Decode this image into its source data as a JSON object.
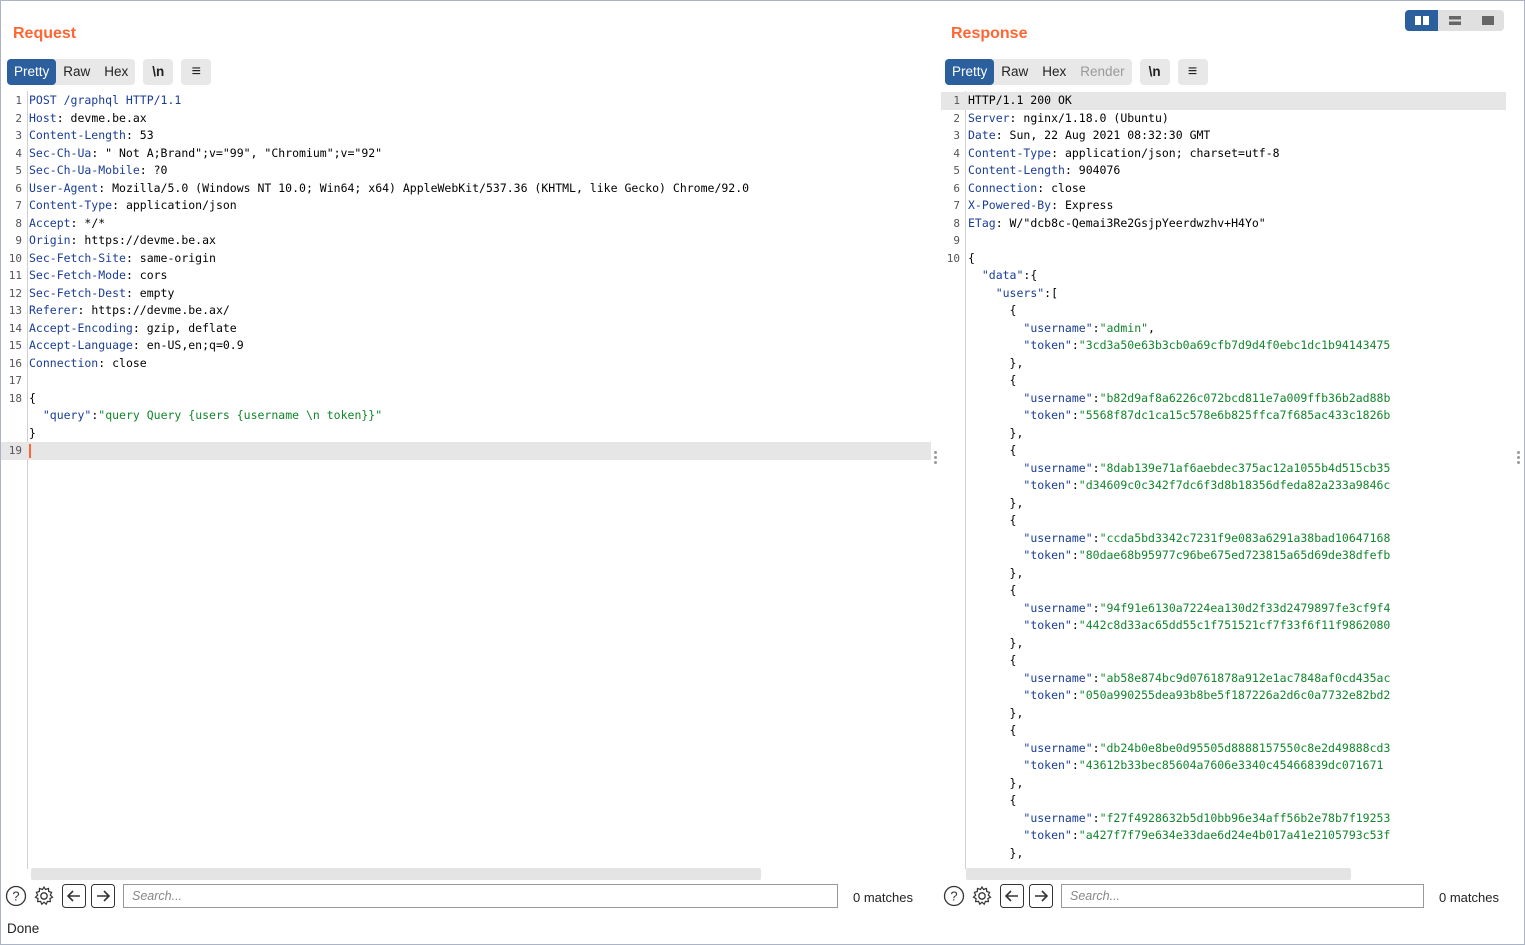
{
  "request": {
    "title": "Request",
    "tabs": [
      "Pretty",
      "Raw",
      "Hex"
    ],
    "active_tab": "Pretty",
    "newline_btn": "\\n",
    "lines": [
      [
        [
          "k",
          "POST /graphql HTTP/1.1"
        ]
      ],
      [
        [
          "k",
          "Host"
        ],
        [
          "p",
          ": devme.be.ax"
        ]
      ],
      [
        [
          "k",
          "Content-Length"
        ],
        [
          "p",
          ": 53"
        ]
      ],
      [
        [
          "k",
          "Sec-Ch-Ua"
        ],
        [
          "p",
          ": \" Not A;Brand\";v=\"99\", \"Chromium\";v=\"92\""
        ]
      ],
      [
        [
          "k",
          "Sec-Ch-Ua-Mobile"
        ],
        [
          "p",
          ": ?0"
        ]
      ],
      [
        [
          "k",
          "User-Agent"
        ],
        [
          "p",
          ": Mozilla/5.0 (Windows NT 10.0; Win64; x64) AppleWebKit/537.36 (KHTML, like Gecko) Chrome/92.0"
        ]
      ],
      [
        [
          "k",
          "Content-Type"
        ],
        [
          "p",
          ": application/json"
        ]
      ],
      [
        [
          "k",
          "Accept"
        ],
        [
          "p",
          ": */*"
        ]
      ],
      [
        [
          "k",
          "Origin"
        ],
        [
          "p",
          ": https://devme.be.ax"
        ]
      ],
      [
        [
          "k",
          "Sec-Fetch-Site"
        ],
        [
          "p",
          ": same-origin"
        ]
      ],
      [
        [
          "k",
          "Sec-Fetch-Mode"
        ],
        [
          "p",
          ": cors"
        ]
      ],
      [
        [
          "k",
          "Sec-Fetch-Dest"
        ],
        [
          "p",
          ": empty"
        ]
      ],
      [
        [
          "k",
          "Referer"
        ],
        [
          "p",
          ": https://devme.be.ax/"
        ]
      ],
      [
        [
          "k",
          "Accept-Encoding"
        ],
        [
          "p",
          ": gzip, deflate"
        ]
      ],
      [
        [
          "k",
          "Accept-Language"
        ],
        [
          "p",
          ": en-US,en;q=0.9"
        ]
      ],
      [
        [
          "k",
          "Connection"
        ],
        [
          "p",
          ": close"
        ]
      ],
      [],
      [
        [
          "p",
          "{"
        ]
      ],
      [
        [
          "p",
          "  "
        ],
        [
          "k",
          "\"query\""
        ],
        [
          "p",
          ":"
        ],
        [
          "s",
          "\"query Query {users {username \\n token}}\""
        ]
      ],
      [
        [
          "p",
          "}"
        ]
      ],
      []
    ],
    "line_numbers": [
      "1",
      "2",
      "3",
      "4",
      "5",
      "6",
      "7",
      "8",
      "9",
      "10",
      "11",
      "12",
      "13",
      "14",
      "15",
      "16",
      "17",
      "18",
      "",
      "",
      "19"
    ],
    "search_placeholder": "Search...",
    "matches": "0 matches"
  },
  "response": {
    "title": "Response",
    "tabs": [
      "Pretty",
      "Raw",
      "Hex",
      "Render"
    ],
    "active_tab": "Pretty",
    "disabled_tab": "Render",
    "newline_btn": "\\n",
    "lines": [
      [
        [
          "p",
          "HTTP/1.1 200 OK"
        ]
      ],
      [
        [
          "k",
          "Server"
        ],
        [
          "p",
          ": nginx/1.18.0 (Ubuntu)"
        ]
      ],
      [
        [
          "k",
          "Date"
        ],
        [
          "p",
          ": Sun, 22 Aug 2021 08:32:30 GMT"
        ]
      ],
      [
        [
          "k",
          "Content-Type"
        ],
        [
          "p",
          ": application/json; charset=utf-8"
        ]
      ],
      [
        [
          "k",
          "Content-Length"
        ],
        [
          "p",
          ": 904076"
        ]
      ],
      [
        [
          "k",
          "Connection"
        ],
        [
          "p",
          ": close"
        ]
      ],
      [
        [
          "k",
          "X-Powered-By"
        ],
        [
          "p",
          ": Express"
        ]
      ],
      [
        [
          "k",
          "ETag"
        ],
        [
          "p",
          ": W/\"dcb8c-Qemai3Re2GsjpYeerdwzhv+H4Yo\""
        ]
      ],
      [],
      [
        [
          "p",
          "{"
        ]
      ],
      [
        [
          "p",
          "  "
        ],
        [
          "k",
          "\"data\""
        ],
        [
          "p",
          ":{"
        ]
      ],
      [
        [
          "p",
          "    "
        ],
        [
          "k",
          "\"users\""
        ],
        [
          "p",
          ":["
        ]
      ],
      [
        [
          "p",
          "      {"
        ]
      ],
      [
        [
          "p",
          "        "
        ],
        [
          "k",
          "\"username\""
        ],
        [
          "p",
          ":"
        ],
        [
          "s",
          "\"admin\""
        ],
        [
          "p",
          ","
        ]
      ],
      [
        [
          "p",
          "        "
        ],
        [
          "k",
          "\"token\""
        ],
        [
          "p",
          ":"
        ],
        [
          "s",
          "\"3cd3a50e63b3cb0a69cfb7d9d4f0ebc1dc1b94143475"
        ]
      ],
      [
        [
          "p",
          "      },"
        ]
      ],
      [
        [
          "p",
          "      {"
        ]
      ],
      [
        [
          "p",
          "        "
        ],
        [
          "k",
          "\"username\""
        ],
        [
          "p",
          ":"
        ],
        [
          "s",
          "\"b82d9af8a6226c072bcd811e7a009ffb36b2ad88b"
        ]
      ],
      [
        [
          "p",
          "        "
        ],
        [
          "k",
          "\"token\""
        ],
        [
          "p",
          ":"
        ],
        [
          "s",
          "\"5568f87dc1ca15c578e6b825ffca7f685ac433c1826b"
        ]
      ],
      [
        [
          "p",
          "      },"
        ]
      ],
      [
        [
          "p",
          "      {"
        ]
      ],
      [
        [
          "p",
          "        "
        ],
        [
          "k",
          "\"username\""
        ],
        [
          "p",
          ":"
        ],
        [
          "s",
          "\"8dab139e71af6aebdec375ac12a1055b4d515cb35"
        ]
      ],
      [
        [
          "p",
          "        "
        ],
        [
          "k",
          "\"token\""
        ],
        [
          "p",
          ":"
        ],
        [
          "s",
          "\"d34609c0c342f7dc6f3d8b18356dfeda82a233a9846c"
        ]
      ],
      [
        [
          "p",
          "      },"
        ]
      ],
      [
        [
          "p",
          "      {"
        ]
      ],
      [
        [
          "p",
          "        "
        ],
        [
          "k",
          "\"username\""
        ],
        [
          "p",
          ":"
        ],
        [
          "s",
          "\"ccda5bd3342c7231f9e083a6291a38bad10647168"
        ]
      ],
      [
        [
          "p",
          "        "
        ],
        [
          "k",
          "\"token\""
        ],
        [
          "p",
          ":"
        ],
        [
          "s",
          "\"80dae68b95977c96be675ed723815a65d69de38dfefb"
        ]
      ],
      [
        [
          "p",
          "      },"
        ]
      ],
      [
        [
          "p",
          "      {"
        ]
      ],
      [
        [
          "p",
          "        "
        ],
        [
          "k",
          "\"username\""
        ],
        [
          "p",
          ":"
        ],
        [
          "s",
          "\"94f91e6130a7224ea130d2f33d2479897fe3cf9f4"
        ]
      ],
      [
        [
          "p",
          "        "
        ],
        [
          "k",
          "\"token\""
        ],
        [
          "p",
          ":"
        ],
        [
          "s",
          "\"442c8d33ac65dd55c1f751521cf7f33f6f11f9862080"
        ]
      ],
      [
        [
          "p",
          "      },"
        ]
      ],
      [
        [
          "p",
          "      {"
        ]
      ],
      [
        [
          "p",
          "        "
        ],
        [
          "k",
          "\"username\""
        ],
        [
          "p",
          ":"
        ],
        [
          "s",
          "\"ab58e874bc9d0761878a912e1ac7848af0cd435ac"
        ]
      ],
      [
        [
          "p",
          "        "
        ],
        [
          "k",
          "\"token\""
        ],
        [
          "p",
          ":"
        ],
        [
          "s",
          "\"050a990255dea93b8be5f187226a2d6c0a7732e82bd2"
        ]
      ],
      [
        [
          "p",
          "      },"
        ]
      ],
      [
        [
          "p",
          "      {"
        ]
      ],
      [
        [
          "p",
          "        "
        ],
        [
          "k",
          "\"username\""
        ],
        [
          "p",
          ":"
        ],
        [
          "s",
          "\"db24b0e8be0d95505d8888157550c8e2d49888cd3"
        ]
      ],
      [
        [
          "p",
          "        "
        ],
        [
          "k",
          "\"token\""
        ],
        [
          "p",
          ":"
        ],
        [
          "s",
          "\"43612b33bec85604a7606e3340c45466839dc071671"
        ]
      ],
      [
        [
          "p",
          "      },"
        ]
      ],
      [
        [
          "p",
          "      {"
        ]
      ],
      [
        [
          "p",
          "        "
        ],
        [
          "k",
          "\"username\""
        ],
        [
          "p",
          ":"
        ],
        [
          "s",
          "\"f27f4928632b5d10bb96e34aff56b2e78b7f19253"
        ]
      ],
      [
        [
          "p",
          "        "
        ],
        [
          "k",
          "\"token\""
        ],
        [
          "p",
          ":"
        ],
        [
          "s",
          "\"a427f7f79e634e33dae6d24e4b017a41e2105793c53f"
        ]
      ],
      [
        [
          "p",
          "      },"
        ]
      ]
    ],
    "line_numbers": [
      "1",
      "2",
      "3",
      "4",
      "5",
      "6",
      "7",
      "8",
      "9",
      "10"
    ],
    "search_placeholder": "Search...",
    "matches": "0 matches"
  },
  "status": "Done",
  "colors": {
    "accent": "#ff6633",
    "active_tab": "#2b5f9e",
    "header_key": "#1a3d96",
    "json_string": "#11862b"
  },
  "icons": [
    "help-icon",
    "settings-icon",
    "arrow-left-icon",
    "arrow-right-icon",
    "menu-icon",
    "layout-columns-icon",
    "layout-rows-icon",
    "layout-single-icon"
  ]
}
